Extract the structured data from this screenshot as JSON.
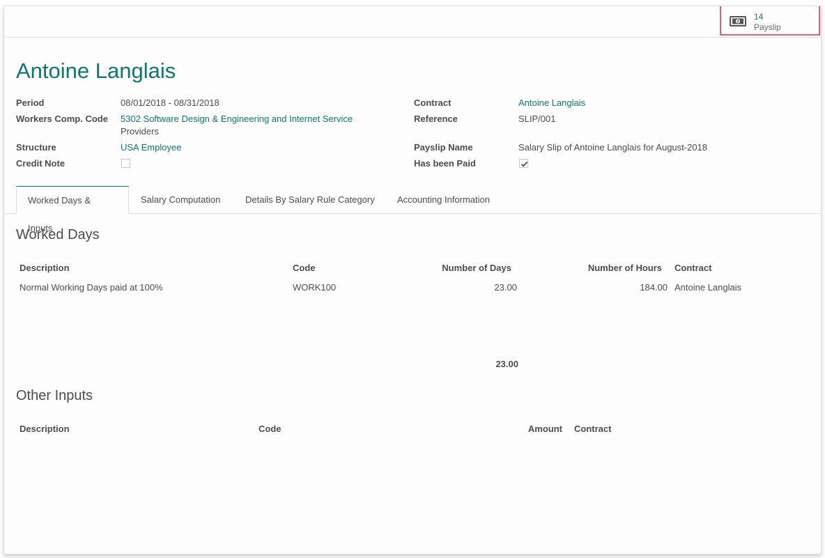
{
  "smart_button": {
    "value": "14",
    "label": "Payslip",
    "icon": "money-icon"
  },
  "title": "Antoine Langlais",
  "fields": {
    "period": {
      "label": "Period",
      "value": "08/01/2018 - 08/31/2018"
    },
    "workers_comp": {
      "label": "Workers Comp. Code",
      "value_link": "5302 Software Design & Engineering and Internet Service",
      "value_rest": "Providers"
    },
    "structure": {
      "label": "Structure",
      "value": "USA Employee"
    },
    "credit_note": {
      "label": "Credit Note",
      "checked": false
    },
    "contract": {
      "label": "Contract",
      "value": "Antoine Langlais"
    },
    "reference": {
      "label": "Reference",
      "value": "SLIP/001"
    },
    "payslip_name": {
      "label": "Payslip Name",
      "value": "Salary Slip of Antoine Langlais for August-2018"
    },
    "has_been_paid": {
      "label": "Has been Paid",
      "checked": true
    }
  },
  "tabs": [
    {
      "label": "Worked Days & Inputs",
      "active": true
    },
    {
      "label": "Salary Computation",
      "active": false
    },
    {
      "label": "Details By Salary Rule Category",
      "active": false
    },
    {
      "label": "Accounting Information",
      "active": false
    }
  ],
  "worked_days": {
    "title": "Worked Days",
    "columns": [
      "Description",
      "Code",
      "Number of Days",
      "Number of Hours",
      "Contract"
    ],
    "rows": [
      [
        "Normal Working Days paid at 100%",
        "WORK100",
        "23.00",
        "184.00",
        "Antoine Langlais"
      ]
    ],
    "total_days": "23.00"
  },
  "other_inputs": {
    "title": "Other Inputs",
    "columns": [
      "Description",
      "Code",
      "Amount",
      "Contract"
    ]
  },
  "colors": {
    "accent": "#11766f",
    "highlight_border": "#d9607f",
    "link_blue": "#1a6fa3"
  }
}
